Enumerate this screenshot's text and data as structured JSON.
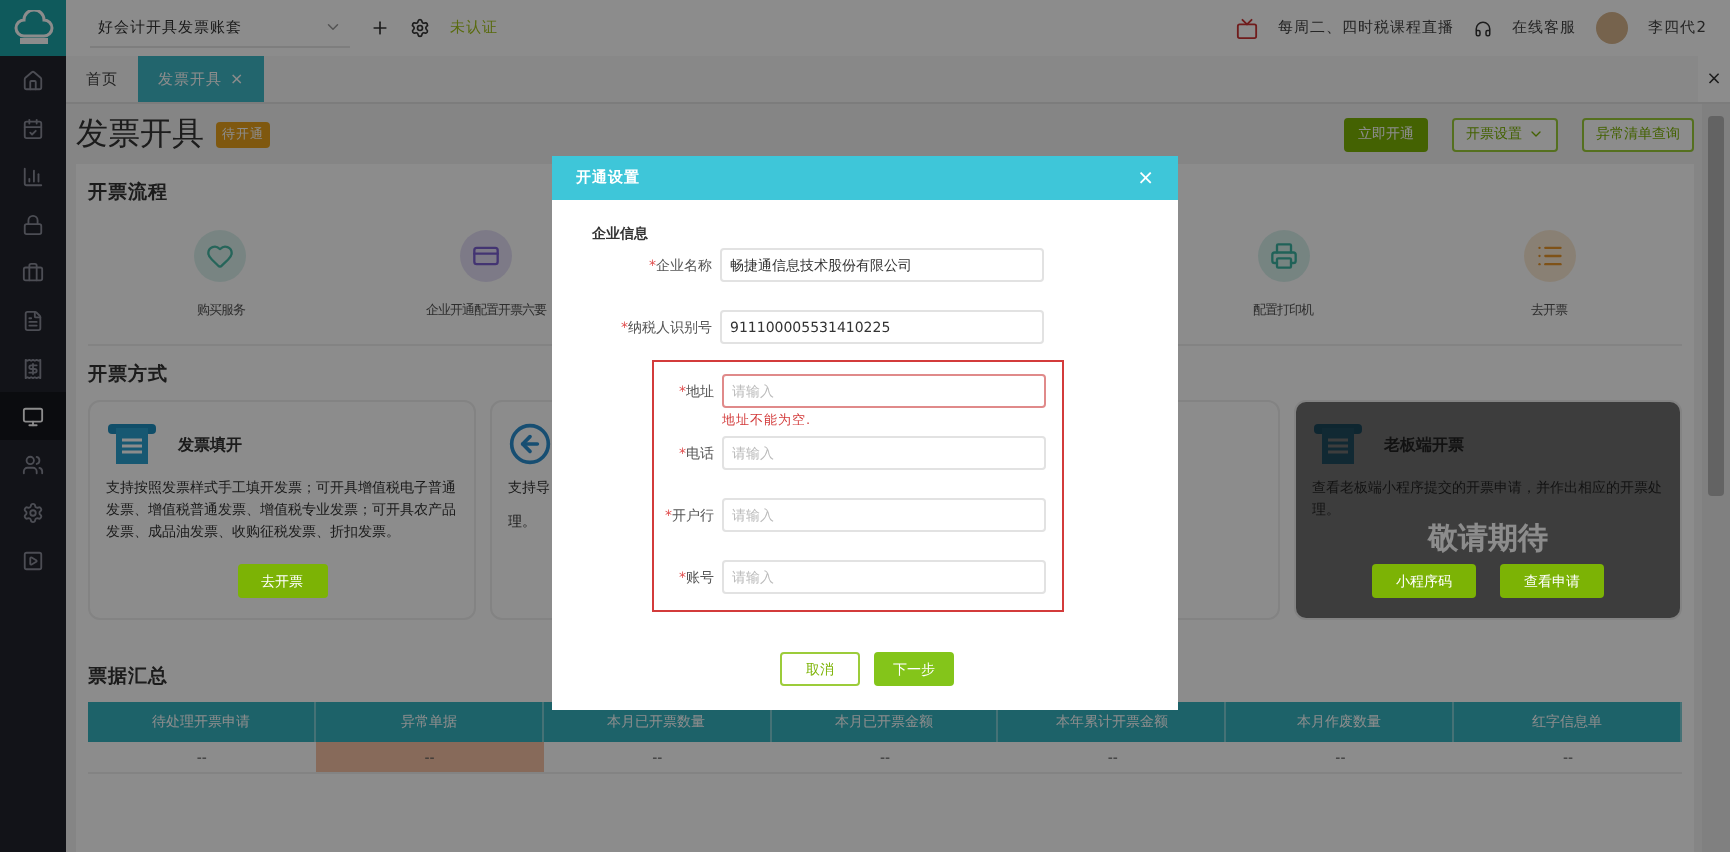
{
  "sidebar": {
    "items": [
      {
        "selected": false
      },
      {
        "selected": false
      },
      {
        "selected": false
      },
      {
        "selected": false
      },
      {
        "selected": false
      },
      {
        "selected": false
      },
      {
        "selected": false
      },
      {
        "selected": true
      },
      {
        "selected": false
      },
      {
        "selected": false
      },
      {
        "selected": false
      }
    ]
  },
  "top_bar": {
    "account": "好会计开具发票账套",
    "auth_status": "未认证",
    "promo": "每周二、四时税课程直播",
    "support": "在线客服",
    "user": "李四代2"
  },
  "tabs": [
    {
      "label": "首页",
      "selected": false
    },
    {
      "label": "发票开具",
      "selected": true,
      "close": "×"
    }
  ],
  "panel_close": "×",
  "page": {
    "title": "发票开具",
    "badge": "待开通",
    "actions": [
      {
        "label": "立即开通",
        "kind": "primary"
      },
      {
        "label": "开票设置",
        "kind": "dropdown"
      },
      {
        "label": "异常清单查询",
        "kind": "outline"
      }
    ]
  },
  "flow": {
    "title": "开票流程",
    "steps": [
      {
        "label": "购买服务"
      },
      {
        "label": "企业开通配置开票六要"
      },
      {
        "label": "配置打印机"
      },
      {
        "label": "去开票"
      }
    ]
  },
  "methods": {
    "title": "开票方式",
    "cards": [
      {
        "kind": "full",
        "title": "发票填开",
        "desc": "支持按照发票样式手工填开发票；可开具增值税电子普通发票、增值税普通发票、增值税专业发票；可开具农产品发票、成品油发票、收购征税发票、折扣发票。",
        "buttons": [
          "去开票"
        ]
      },
      {
        "kind": "partial",
        "lines": [
          "支持导",
          "理。"
        ]
      },
      {
        "kind": "blank"
      },
      {
        "kind": "full",
        "title": "老板端开票",
        "desc": "查看老板端小程序提交的开票申请，并作出相应的开票处理。",
        "buttons": [
          "小程序码",
          "查看申请"
        ],
        "coming_soon": "敬请期待"
      }
    ]
  },
  "summary": {
    "title": "票据汇总",
    "columns": [
      "待处理开票申请",
      "异常单据",
      "本月已开票数量",
      "本月已开票金额",
      "本年累计开票金额",
      "本月作废数量",
      "红字信息单"
    ],
    "cells": [
      {
        "value": "--",
        "alert": false
      },
      {
        "value": "--",
        "alert": true
      },
      {
        "value": "--",
        "alert": false
      },
      {
        "value": "--",
        "alert": false
      },
      {
        "value": "--",
        "alert": false
      },
      {
        "value": "--",
        "alert": false
      },
      {
        "value": "--",
        "alert": false
      }
    ]
  },
  "dialog": {
    "title": "开通设置",
    "close": "×",
    "section": "企业信息",
    "groups": [
      {
        "highlighted": false,
        "fields": [
          {
            "mark": "*",
            "label": "企业名称",
            "value": "畅捷通信息技术股份有限公司"
          },
          {
            "mark": "*",
            "label": "纳税人识别号",
            "value": "911100005531410225"
          }
        ]
      },
      {
        "highlighted": true,
        "fields": [
          {
            "mark": "*",
            "label": "地址",
            "placeholder": "请输入",
            "error": "地址不能为空."
          },
          {
            "mark": "*",
            "label": "电话",
            "placeholder": "请输入"
          },
          {
            "mark": "*",
            "label": "开户行",
            "placeholder": "请输入"
          },
          {
            "mark": "*",
            "label": "账号",
            "placeholder": "请输入"
          }
        ]
      }
    ],
    "buttons": [
      {
        "label": "取消",
        "kind": "secondary"
      },
      {
        "label": "下一步",
        "kind": "primary"
      }
    ]
  }
}
